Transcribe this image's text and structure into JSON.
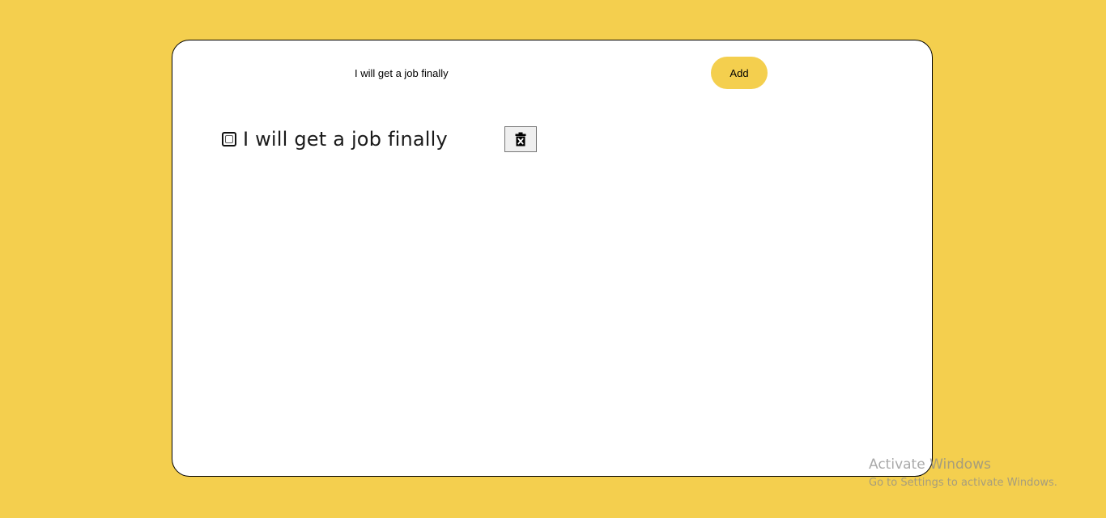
{
  "form": {
    "input_value": "I will get a job finally",
    "add_label": "Add"
  },
  "todos": [
    {
      "text": "I will get a job finally",
      "checked": false
    }
  ],
  "icons": {
    "delete": "trash-x-icon"
  },
  "colors": {
    "background": "#f4cf4e",
    "card": "#ffffff",
    "add_button": "#f4cf4e"
  },
  "system_overlay": {
    "title": "Activate Windows",
    "subtitle": "Go to Settings to activate Windows."
  }
}
